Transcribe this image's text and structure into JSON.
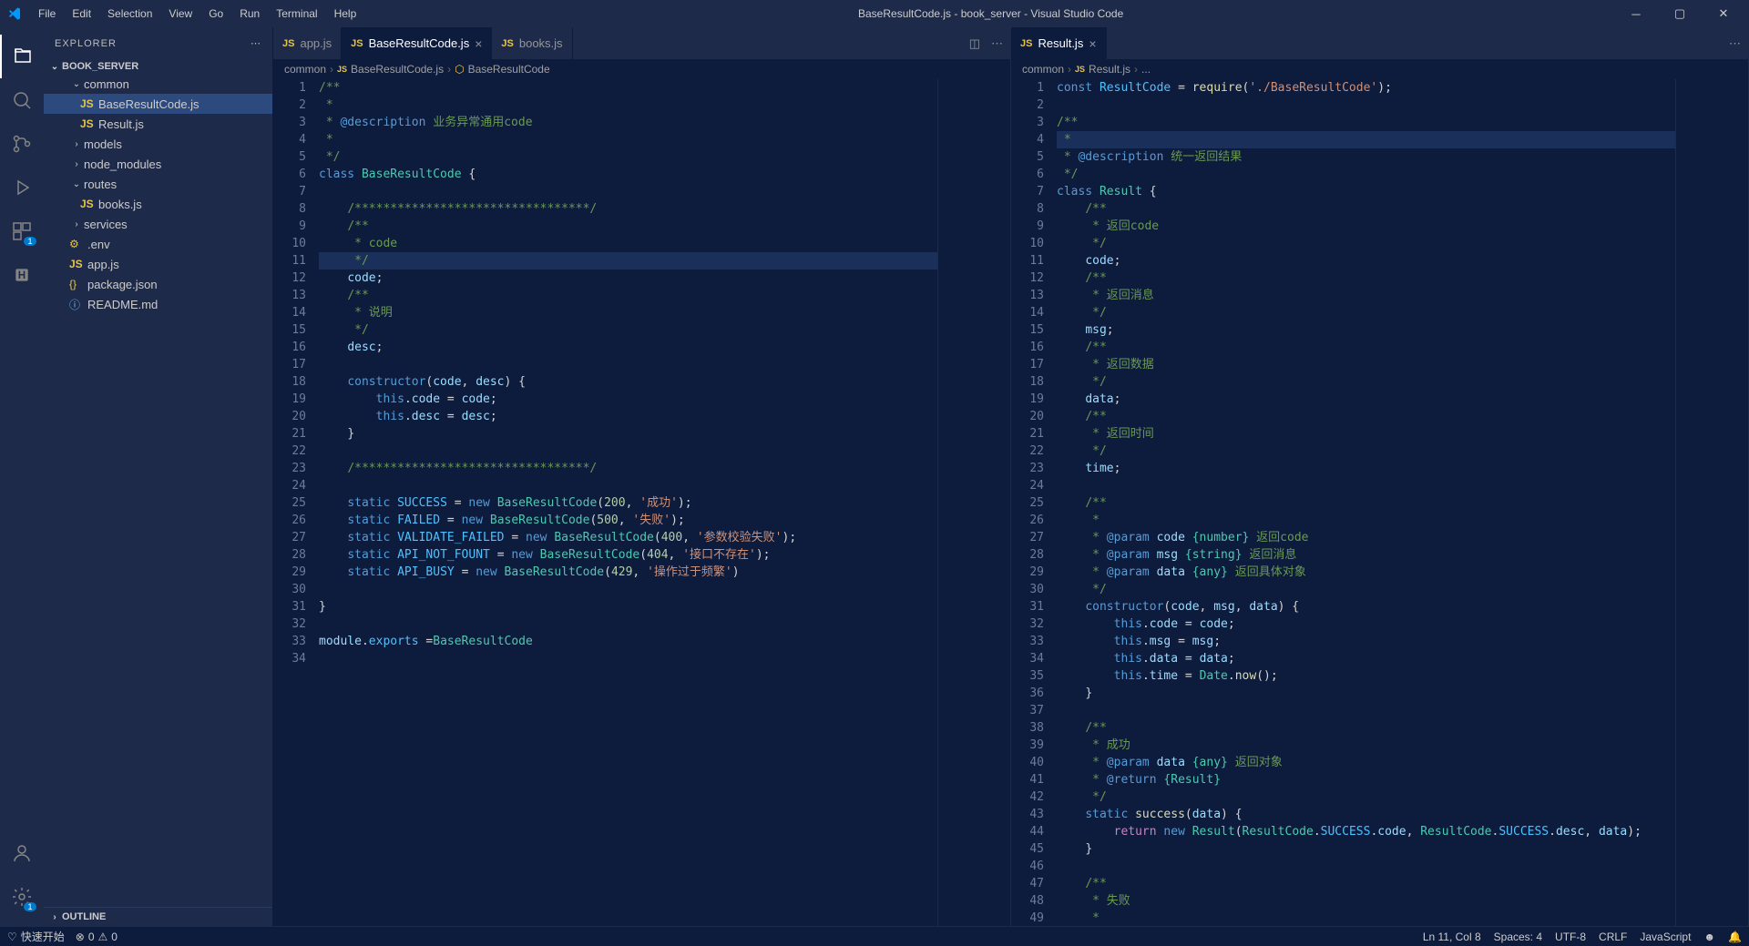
{
  "titlebar": {
    "title": "BaseResultCode.js - book_server - Visual Studio Code",
    "menu": [
      "File",
      "Edit",
      "Selection",
      "View",
      "Go",
      "Run",
      "Terminal",
      "Help"
    ]
  },
  "sidebar": {
    "header": "EXPLORER",
    "project": "BOOK_SERVER",
    "outline": "OUTLINE",
    "tree": [
      {
        "label": "common",
        "type": "folder",
        "expanded": true,
        "indent": 1
      },
      {
        "label": "BaseResultCode.js",
        "type": "js",
        "indent": 2,
        "selected": true
      },
      {
        "label": "Result.js",
        "type": "js",
        "indent": 2
      },
      {
        "label": "models",
        "type": "folder",
        "expanded": false,
        "indent": 1
      },
      {
        "label": "node_modules",
        "type": "folder",
        "expanded": false,
        "indent": 1
      },
      {
        "label": "routes",
        "type": "folder",
        "expanded": true,
        "indent": 1
      },
      {
        "label": "books.js",
        "type": "js",
        "indent": 2
      },
      {
        "label": "services",
        "type": "folder",
        "expanded": false,
        "indent": 1
      },
      {
        "label": ".env",
        "type": "env",
        "indent": 1
      },
      {
        "label": "app.js",
        "type": "js",
        "indent": 1
      },
      {
        "label": "package.json",
        "type": "json",
        "indent": 1
      },
      {
        "label": "README.md",
        "type": "md",
        "indent": 1
      }
    ]
  },
  "tabs_left": [
    {
      "label": "app.js",
      "active": false
    },
    {
      "label": "BaseResultCode.js",
      "active": true,
      "close": true
    },
    {
      "label": "books.js",
      "active": false
    }
  ],
  "tabs_right": [
    {
      "label": "Result.js",
      "active": true,
      "close": true
    }
  ],
  "breadcrumb_left": [
    "common",
    "BaseResultCode.js",
    "BaseResultCode"
  ],
  "breadcrumb_right": [
    "common",
    "Result.js",
    "..."
  ],
  "statusbar": {
    "launch": "快速开始",
    "errors": "0",
    "warnings": "0",
    "line_col": "Ln 11, Col 8",
    "spaces": "Spaces: 4",
    "encoding": "UTF-8",
    "eol": "CRLF",
    "language": "JavaScript"
  },
  "code_left_comments": {
    "desc": "@description",
    "desc_text": "业务异常通用code",
    "code_cmt": "code",
    "desc2_cmt": "说明"
  },
  "code_left_vals": {
    "success": "SUCCESS",
    "success_code": "200",
    "success_msg": "'成功'",
    "failed": "FAILED",
    "failed_code": "500",
    "failed_msg": "'失败'",
    "validate": "VALIDATE_FAILED",
    "validate_code": "400",
    "validate_msg": "'参数校验失败'",
    "notfound": "API_NOT_FOUNT",
    "notfound_code": "404",
    "notfound_msg": "'接口不存在'",
    "busy": "API_BUSY",
    "busy_code": "429",
    "busy_msg": "'操作过于频繁'"
  },
  "code_right_comments": {
    "desc": "@description",
    "desc_text": "统一返回结果",
    "ret_code": "返回code",
    "ret_msg": "返回消息",
    "ret_data": "返回数据",
    "ret_time": "返回时间",
    "param_code": "返回code",
    "param_msg": "返回消息",
    "param_data": "返回具体对象",
    "success_cmt": "成功",
    "ret_obj": "返回对象",
    "fail_cmt": "失败"
  }
}
